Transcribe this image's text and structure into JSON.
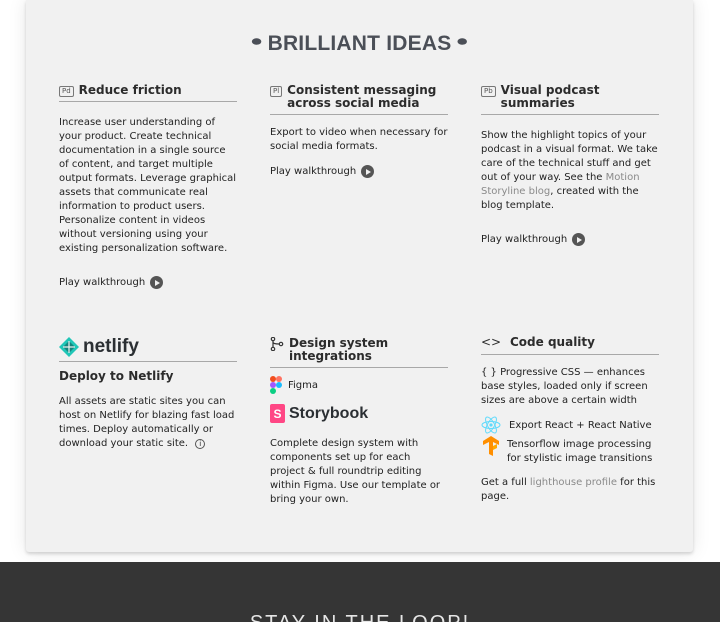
{
  "section": {
    "title": "BRILLIANT IDEAS",
    "title_icon": "coffee-bean-icon"
  },
  "cards": {
    "reduce": {
      "badge": "Pd",
      "title": "Reduce friction",
      "body": "Increase user understanding of your product. Create technical documentation in a single source of content, and target multiple output formats. Leverage graphical assets that communicate real information to product users. Personalize content in videos without versioning using your existing personalization software.",
      "walk": "Play walkthrough"
    },
    "messaging": {
      "badge": "Pl",
      "title": "Consistent messaging across social media",
      "body": "Export to video when necessary for social media formats.",
      "walk": "Play walkthrough"
    },
    "podcast": {
      "badge": "Pb",
      "title": "Visual podcast summaries",
      "body_before": "Show the highlight topics of your podcast in a visual format. We take care of the technical stuff and get out of your way. See the ",
      "link": "Motion Storyline blog",
      "body_after": ", created with the blog template.",
      "walk": "Play walkthrough"
    },
    "netlify": {
      "logo_text": "netlify",
      "title": "Deploy to Netlify",
      "body": "All assets are static sites you can host on Netlify for blazing fast load times. Deploy automatically or download your static site."
    },
    "design": {
      "title": "Design system integrations",
      "figma": "Figma",
      "storybook": "Storybook",
      "body": "Complete design system with components set up for each project & full roundtrip editing within Figma. Use our template or bring your own."
    },
    "code": {
      "title": "Code quality",
      "css": "{ } Progressive CSS — enhances base styles, loaded only if screen sizes are above a certain width",
      "react": "Export React + React Native",
      "tensorflow": "Tensorflow image processing for stylistic image transitions",
      "lh_before": "Get a full ",
      "lh_link": "lighthouse profile",
      "lh_after": " for this page."
    }
  },
  "footer": {
    "title": "STAY IN THE LOOP!"
  },
  "colors": {
    "card_bg": "#f1f1f1",
    "footer_bg": "#353535",
    "netlify": "#20c6b7",
    "storybook": "#ff4785",
    "react": "#61dafb",
    "tensorflow": "#ff8f00"
  }
}
